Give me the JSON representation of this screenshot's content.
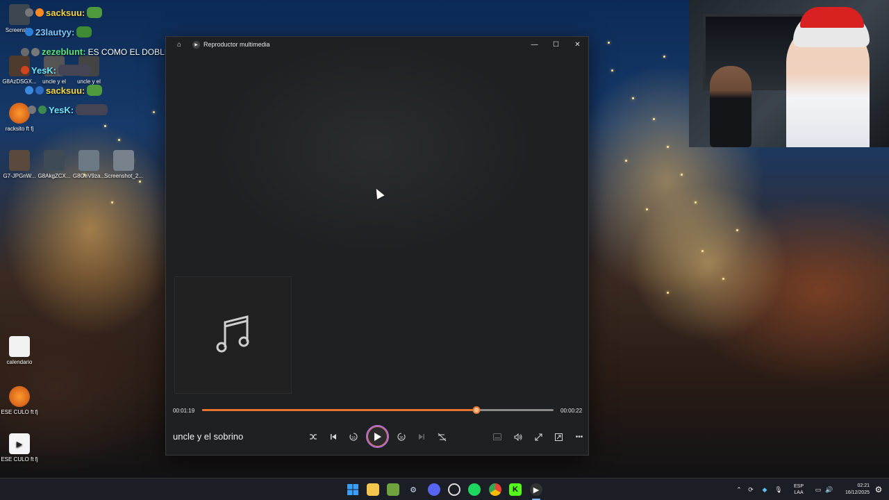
{
  "player": {
    "title": "Reproductor multimedia",
    "track_name": "uncle y el sobrino",
    "elapsed": "00:01:19",
    "remaining": "00:00:22",
    "progress_fraction": 0.78,
    "accent_color": "#e8742e"
  },
  "chat": [
    {
      "user": "sacksuu:",
      "message": "",
      "color": "#f5d742"
    },
    {
      "user": "23lautyy:",
      "message": "",
      "color": "#7fc8ff"
    },
    {
      "user": "zezeblunt:",
      "message": "ES COMO EL DOBLE COP",
      "color": "#5ee37c"
    },
    {
      "user": "YesK:",
      "message": "",
      "color": "#6ee6ff"
    },
    {
      "user": "sacksuu:",
      "message": "",
      "color": "#f5d742"
    },
    {
      "user": "YesK:",
      "message": "",
      "color": "#6ee6ff"
    }
  ],
  "desktop_icons": [
    {
      "label": "Screensh..."
    },
    {
      "label": "G8AzDSGX..."
    },
    {
      "label": "uncle y el"
    },
    {
      "label": "uncle y el"
    },
    {
      "label": "racksito ft fj"
    },
    {
      "label": "G7-JPGnW..."
    },
    {
      "label": "G8AkgZCX..."
    },
    {
      "label": "G8GeV9za..."
    },
    {
      "label": "Screenshot_2..."
    },
    {
      "label": "calendario"
    },
    {
      "label": "ESE CULO ft fj"
    },
    {
      "label": "ESE CULO ft fj"
    }
  ],
  "taskbar": {
    "language": "ESP",
    "language_sub": "LAA",
    "time": "02:21",
    "date": "16/12/2025",
    "apps": [
      "start-icon",
      "file-explorer-icon",
      "minecraft-icon",
      "steam-icon",
      "discord-icon",
      "obs-icon",
      "spotify-icon",
      "chrome-icon",
      "kick-icon",
      "media-player-icon"
    ]
  }
}
